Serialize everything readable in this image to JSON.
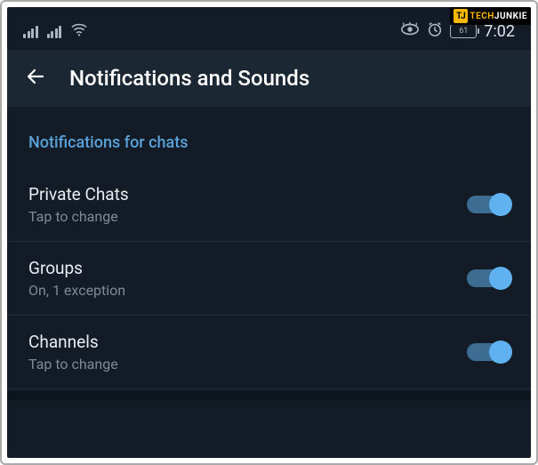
{
  "watermark": {
    "logo": "TJ",
    "text1": "TECH",
    "text2": "JUNKIE"
  },
  "statusbar": {
    "battery": "61",
    "time": "7:02"
  },
  "header": {
    "title": "Notifications and Sounds"
  },
  "section": {
    "title": "Notifications for chats"
  },
  "settings": [
    {
      "title": "Private Chats",
      "subtitle": "Tap to change",
      "on": true
    },
    {
      "title": "Groups",
      "subtitle": "On, 1 exception",
      "on": true
    },
    {
      "title": "Channels",
      "subtitle": "Tap to change",
      "on": true
    }
  ]
}
